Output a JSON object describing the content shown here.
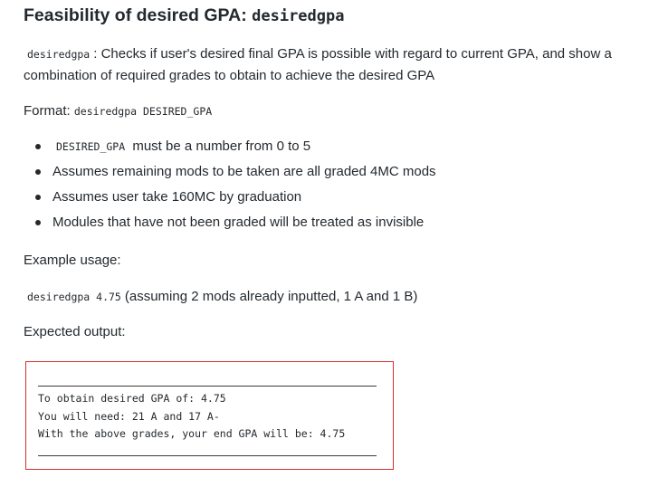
{
  "heading": {
    "text": "Feasibility of desired GPA: ",
    "code": "desiredgpa"
  },
  "description": {
    "code": "desiredgpa",
    "text": ": Checks if user's desired final GPA is possible with regard to current GPA, and show a combination of required grades to obtain to achieve the desired GPA"
  },
  "format": {
    "label": "Format: ",
    "code": "desiredgpa DESIRED_GPA"
  },
  "bullets": [
    {
      "code": "DESIRED_GPA",
      "text": "must be a number from 0 to 5"
    },
    {
      "code": "",
      "text": "Assumes remaining mods to be taken are all graded 4MC mods"
    },
    {
      "code": "",
      "text": "Assumes user take 160MC by graduation"
    },
    {
      "code": "",
      "text": "Modules that have not been graded will be treated as invisible"
    }
  ],
  "example_label": "Example usage:",
  "example": {
    "code": "desiredgpa 4.75",
    "text": "(assuming 2 mods already inputted, 1 A and 1 B)"
  },
  "expected_label": "Expected output:",
  "output": {
    "lines": [
      "To obtain desired GPA of: 4.75",
      "You will need: 21 A and 17 A-",
      "With the above grades, your end GPA will be: 4.75"
    ],
    "border_color": "#d9302c"
  }
}
